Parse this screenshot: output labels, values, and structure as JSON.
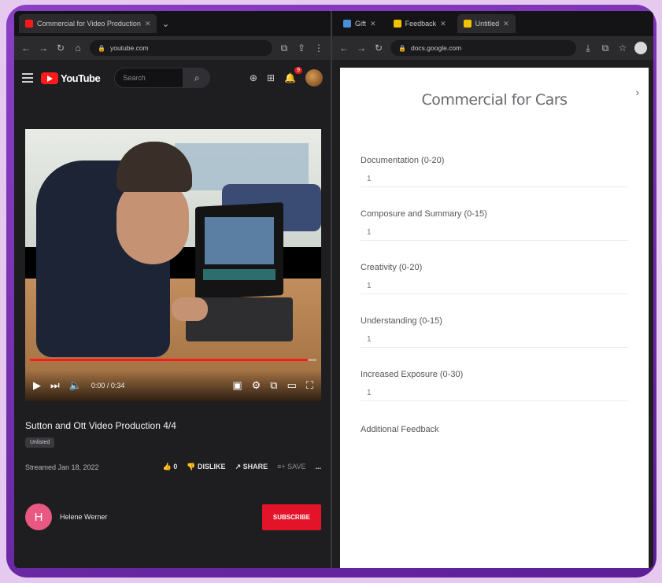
{
  "left_browser": {
    "tabs": [
      {
        "title": "Commercial for Video Production",
        "active": true,
        "favicon_color": "#ff1a1a"
      }
    ],
    "address": "youtube.com"
  },
  "right_browser": {
    "tabs": [
      {
        "title": "Gift",
        "active": false,
        "favicon_color": "#4a90d9"
      },
      {
        "title": "Feedback",
        "active": false,
        "favicon_color": "#f2c200"
      },
      {
        "title": "Untitled",
        "active": true,
        "favicon_color": "#f2c200"
      }
    ],
    "address": "docs.google.com"
  },
  "youtube": {
    "logo_text": "YouTube",
    "search_placeholder": "Search",
    "notification_count": "9",
    "video": {
      "time": "0:00 / 0:34",
      "progress": 0.97,
      "title": "Sutton and Ott Video Production 4/4",
      "tag": "Unlisted",
      "date": "Streamed Jan 18, 2022",
      "views_label": "0",
      "likes": "DISLIKE",
      "dislike_label": "SHARE",
      "share_label": "SAVE",
      "save_label": "..."
    },
    "channel": {
      "initial": "H",
      "name": "Helene Werner",
      "subscribe_label": "Subscribe"
    }
  },
  "rubric": {
    "title": "Commercial for Cars",
    "criteria": [
      {
        "label": "Documentation (0-20)",
        "value": "1"
      },
      {
        "label": "Composure and Summary (0-15)",
        "value": "1"
      },
      {
        "label": "Creativity (0-20)",
        "value": "1"
      },
      {
        "label": "Understanding (0-15)",
        "value": "1"
      },
      {
        "label": "Increased Exposure (0-30)",
        "value": "1"
      }
    ],
    "feedback_label": "Additional Feedback"
  }
}
